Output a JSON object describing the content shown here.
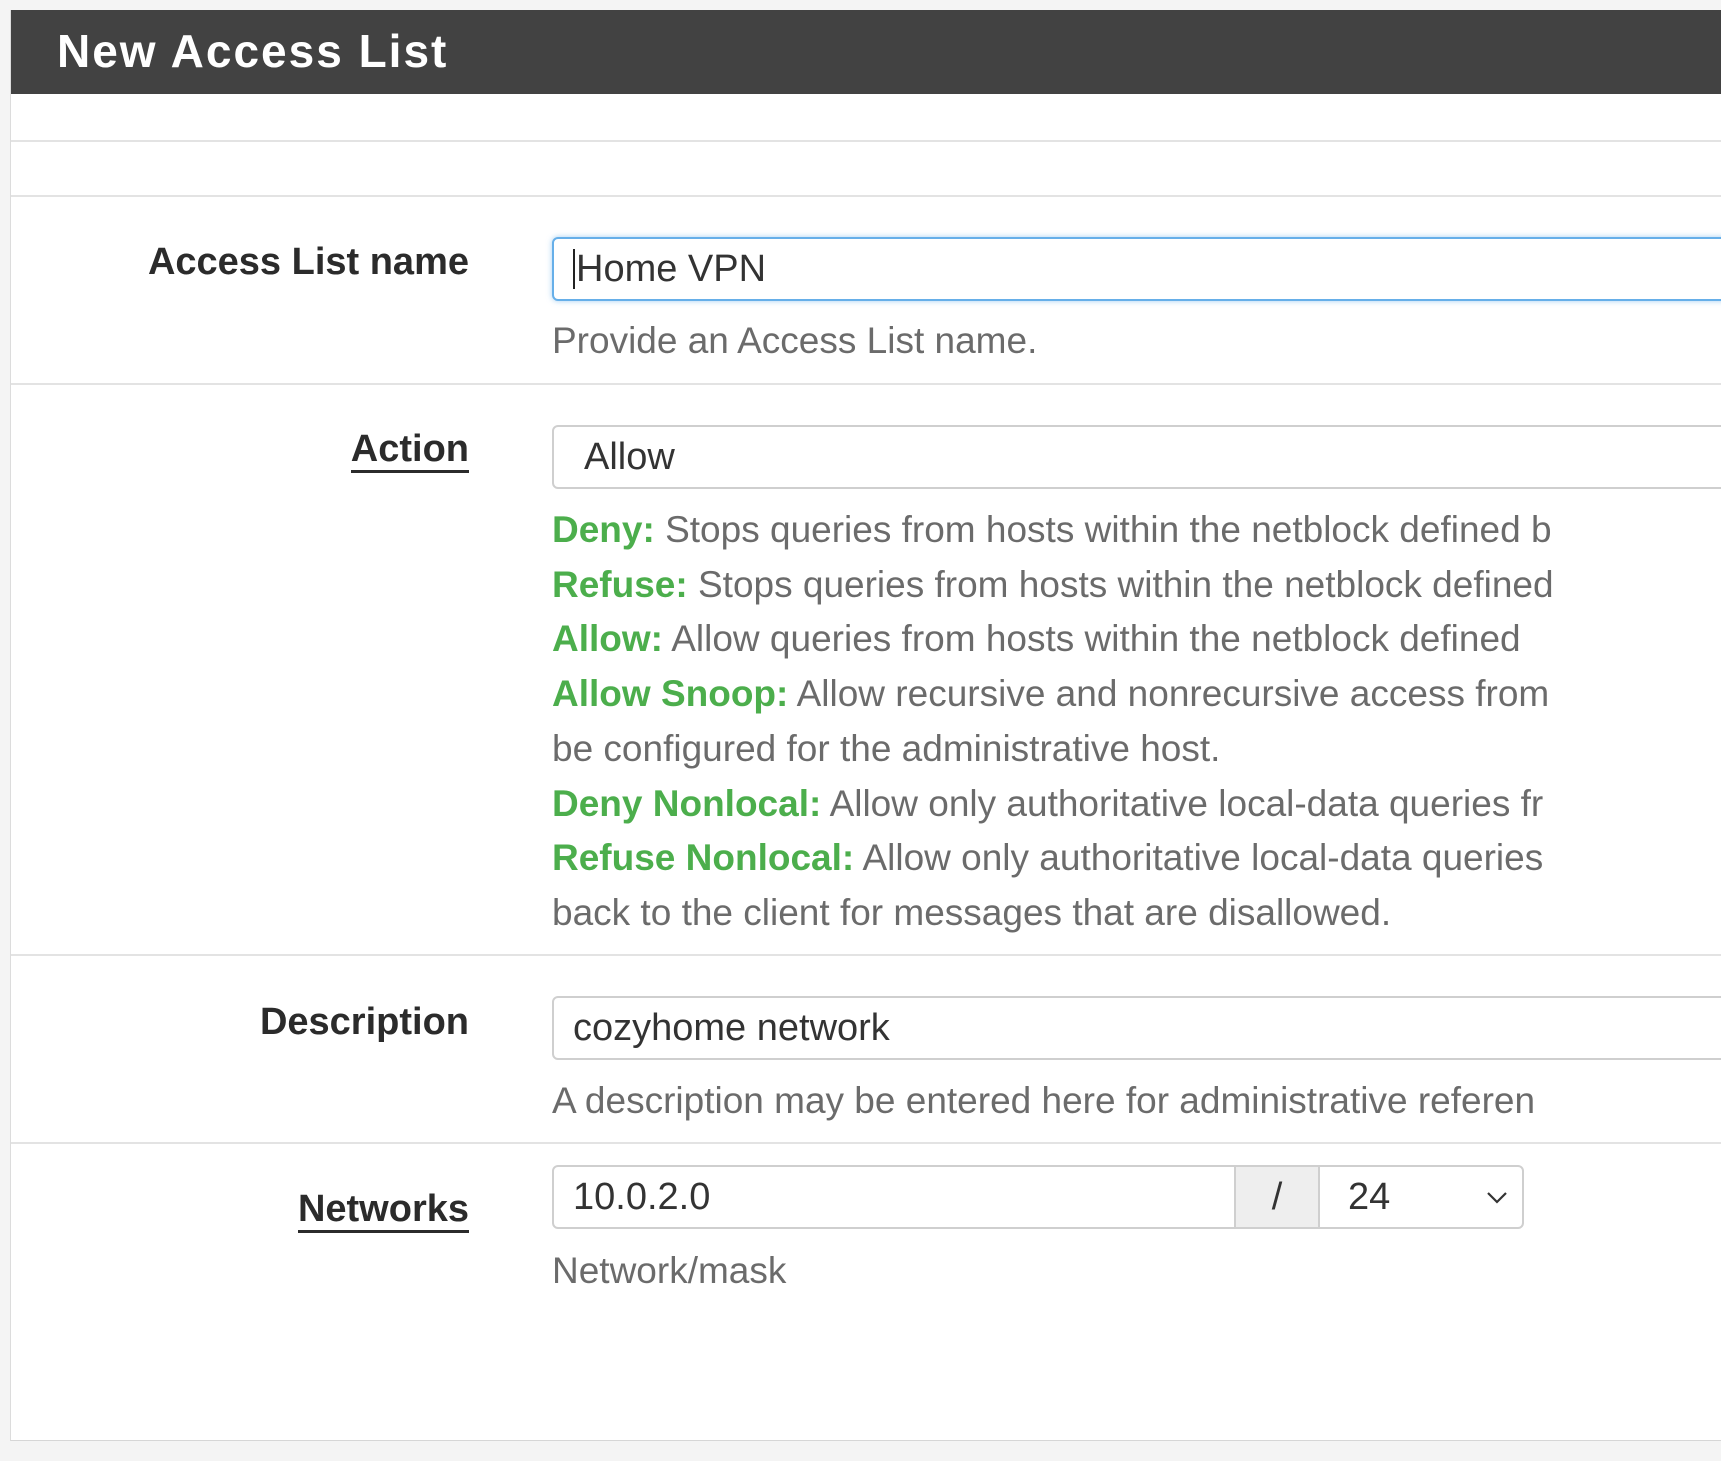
{
  "panel": {
    "title": "New Access List"
  },
  "fields": {
    "name": {
      "label": "Access List name",
      "value": "Home VPN",
      "help": "Provide an Access List name."
    },
    "action": {
      "label": "Action",
      "selected": "Allow",
      "help": [
        {
          "kw": "Deny:",
          "text": " Stops queries from hosts within the netblock defined b"
        },
        {
          "kw": "Refuse:",
          "text": " Stops queries from hosts within the netblock defined"
        },
        {
          "kw": "Allow:",
          "text": " Allow queries from hosts within the netblock defined "
        },
        {
          "kw": "Allow Snoop:",
          "text": " Allow recursive and nonrecursive access from"
        },
        {
          "kw": "",
          "text": "be configured for the administrative host."
        },
        {
          "kw": "Deny Nonlocal:",
          "text": " Allow only authoritative local-data queries fr"
        },
        {
          "kw": "Refuse Nonlocal:",
          "text": " Allow only authoritative local-data queries "
        },
        {
          "kw": "",
          "text": "back to the client for messages that are disallowed."
        }
      ]
    },
    "description": {
      "label": "Description",
      "value": "cozyhome network",
      "help": "A description may be entered here for administrative referen"
    },
    "networks": {
      "label": "Networks",
      "address": "10.0.2.0",
      "separator": "/",
      "mask": "24",
      "help": "Network/mask"
    }
  },
  "colors": {
    "header_bg": "#424242",
    "keyword_green": "#4cae4c",
    "focus_blue": "#66afe9"
  },
  "icons": {
    "mask_dropdown": "chevron-down-icon"
  }
}
